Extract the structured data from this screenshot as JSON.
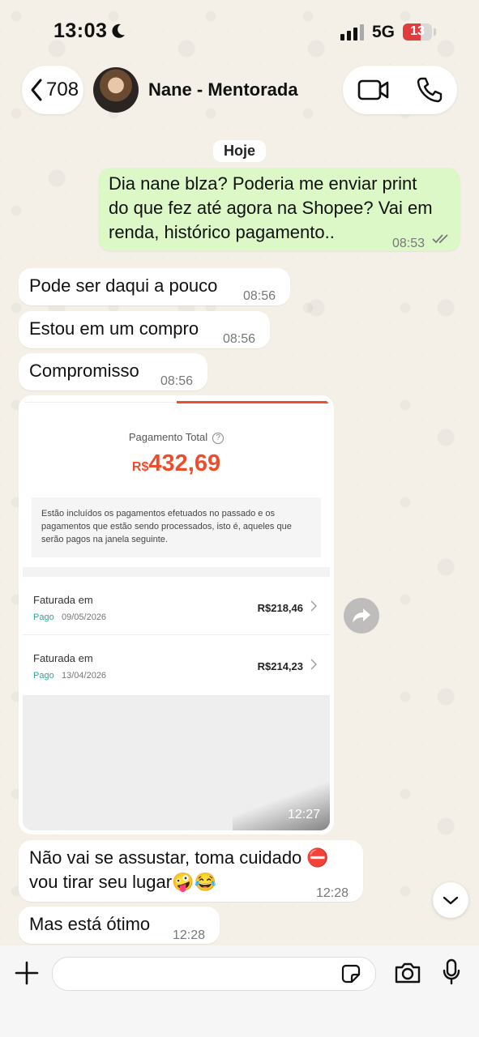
{
  "status_bar": {
    "time": "13:03",
    "network": "5G",
    "battery_level": "13"
  },
  "header": {
    "back_count": "708",
    "contact_name": "Nane - Mentorada"
  },
  "chat": {
    "date_chip": "Hoje",
    "messages": [
      {
        "direction": "out",
        "text_lines": [
          "Dia nane blza? Poderia me enviar print",
          "do que fez até agora na Shopee? Vai em",
          "renda, histórico pagamento.."
        ],
        "time": "08:53"
      },
      {
        "direction": "in",
        "text": "Pode ser daqui a pouco",
        "time": "08:56"
      },
      {
        "direction": "in",
        "text": "Estou em um compro",
        "time": "08:56"
      },
      {
        "direction": "in",
        "text": "Compromisso",
        "time": "08:56"
      },
      {
        "direction": "in",
        "text_lines": [
          "Não vai se assustar, toma cuidado ⛔",
          "vou tirar seu lugar🤪😂"
        ],
        "time": "12:28"
      },
      {
        "direction": "in",
        "text": "Mas está ótimo",
        "time": "12:28"
      }
    ],
    "image_message": {
      "time": "12:27",
      "payment_label": "Pagamento Total",
      "currency": "R$",
      "amount": "432,69",
      "info": "Estão incluídos os pagamentos efetuados no passado e os pagamentos que estão sendo processados, isto é, aqueles que serão pagos na janela seguinte.",
      "rows": [
        {
          "title": "Faturada em",
          "status": "Pago",
          "date": "09/05/2026",
          "amount": "R$218,46"
        },
        {
          "title": "Faturada em",
          "status": "Pago",
          "date": "13/04/2026",
          "amount": "R$214,23"
        }
      ]
    }
  },
  "input": {
    "placeholder": ""
  }
}
